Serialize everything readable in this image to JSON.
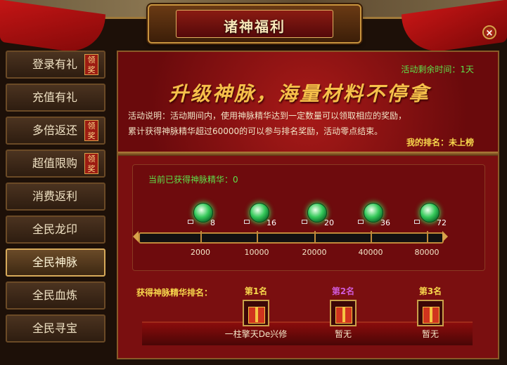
{
  "window": {
    "title": "诸神福利",
    "close_label": "×"
  },
  "sidebar": {
    "items": [
      {
        "label": "登录有礼",
        "badge": "领奖",
        "active": false
      },
      {
        "label": "充值有礼",
        "badge": "",
        "active": false
      },
      {
        "label": "多倍返还",
        "badge": "领奖",
        "active": false
      },
      {
        "label": "超值限购",
        "badge": "领奖",
        "active": false
      },
      {
        "label": "消费返利",
        "badge": "",
        "active": false
      },
      {
        "label": "全民龙印",
        "badge": "",
        "active": false
      },
      {
        "label": "全民神脉",
        "badge": "",
        "active": true
      },
      {
        "label": "全民血炼",
        "badge": "",
        "active": false
      },
      {
        "label": "全民寻宝",
        "badge": "",
        "active": false
      }
    ]
  },
  "header": {
    "countdown": "活动剩余时间：1天",
    "slogan": "升级神脉，海量材料不停拿",
    "desc_line1": "活动说明：活动期间内，使用神脉精华达到一定数量可以领取相应的奖励，",
    "desc_line2": "累计获得神脉精华超过60000的可以参与排名奖励，活动零点结束。",
    "rank_label": "我的排名：",
    "rank_value": "未上榜"
  },
  "progress": {
    "obtained": "当前已获得神脉精华：0",
    "current_value": 0,
    "max_value": 80000,
    "milestones": [
      {
        "count": "8",
        "threshold": "2000"
      },
      {
        "count": "16",
        "threshold": "10000"
      },
      {
        "count": "20",
        "threshold": "20000"
      },
      {
        "count": "36",
        "threshold": "40000"
      },
      {
        "count": "72",
        "threshold": "80000"
      }
    ]
  },
  "ranking": {
    "title": "获得神脉精华排名：",
    "places": [
      {
        "label": "第1名",
        "name": "一柱擎天De兴修",
        "color": "#f7d74c"
      },
      {
        "label": "第2名",
        "name": "暂无",
        "color": "#d05ad8"
      },
      {
        "label": "第3名",
        "name": "暂无",
        "color": "#f7d74c"
      }
    ]
  }
}
